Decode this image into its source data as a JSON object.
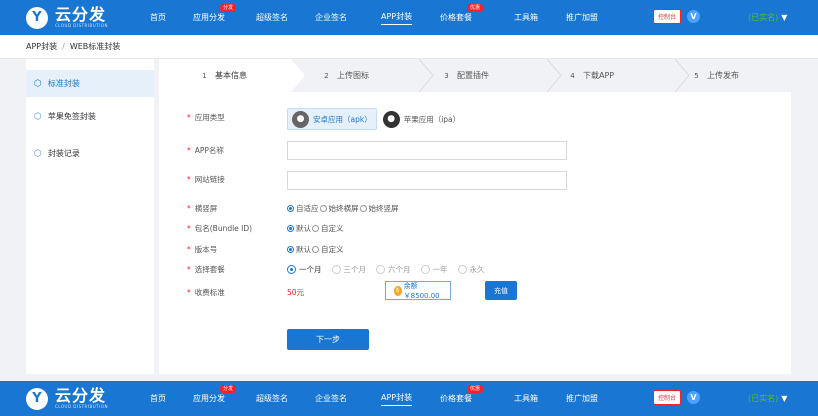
{
  "nav": {
    "logo_mark": "Y",
    "logo_text": "云分发",
    "logo_sub": "CLOUD DISTRIBUTION",
    "items": [
      {
        "label": "首页",
        "badge": ""
      },
      {
        "label": "应用分发",
        "badge": "分发"
      },
      {
        "label": "超级签名",
        "badge": ""
      },
      {
        "label": "企业签名",
        "badge": ""
      },
      {
        "label": "APP封装",
        "badge": ""
      },
      {
        "label": "价格套餐",
        "badge": "优惠"
      },
      {
        "label": "工具箱",
        "badge": ""
      },
      {
        "label": "推广加盟",
        "badge": ""
      }
    ],
    "active_index": 4,
    "control_label": "控制台",
    "v_label": "V",
    "user_label": "(已实名)",
    "caret": "▼"
  },
  "breadcrumb": {
    "part1": "APP封装",
    "separator": "/",
    "part2": "WEB标准封装"
  },
  "sidebar": {
    "items": [
      {
        "label": "标准封装",
        "icon": "cube-icon"
      },
      {
        "label": "苹果免签封装",
        "icon": "cube-icon"
      },
      {
        "label": "封装记录",
        "icon": "cube-icon"
      }
    ]
  },
  "steps": [
    {
      "num": "1",
      "label": "基本信息"
    },
    {
      "num": "2",
      "label": "上传图标"
    },
    {
      "num": "3",
      "label": "配置插件"
    },
    {
      "num": "4",
      "label": "下载APP"
    },
    {
      "num": "5",
      "label": "上传发布"
    }
  ],
  "form": {
    "app_type": {
      "label": "应用类型",
      "android": "安卓应用（apk）",
      "ios": "苹果应用（ipa）"
    },
    "app_name": {
      "label": "APP名称",
      "value": ""
    },
    "site_link": {
      "label": "网站链接",
      "value": ""
    },
    "orientation": {
      "label": "横竖屏",
      "options": [
        "自适应",
        "始终横屏",
        "始终竖屏"
      ]
    },
    "bundle": {
      "label": "包名(Bundle ID)",
      "options": [
        "默认",
        "自定义"
      ]
    },
    "version": {
      "label": "版本号",
      "options": [
        "默认",
        "自定义"
      ]
    },
    "plan": {
      "label": "选择套餐",
      "options": [
        "一个月",
        "三个月",
        "六个月",
        "一年",
        "永久"
      ]
    },
    "fee": {
      "label": "收费标准",
      "price": "50元",
      "balance": "余额￥8500.00",
      "recharge": "充值"
    },
    "next": "下一步",
    "required_mark": "*"
  }
}
